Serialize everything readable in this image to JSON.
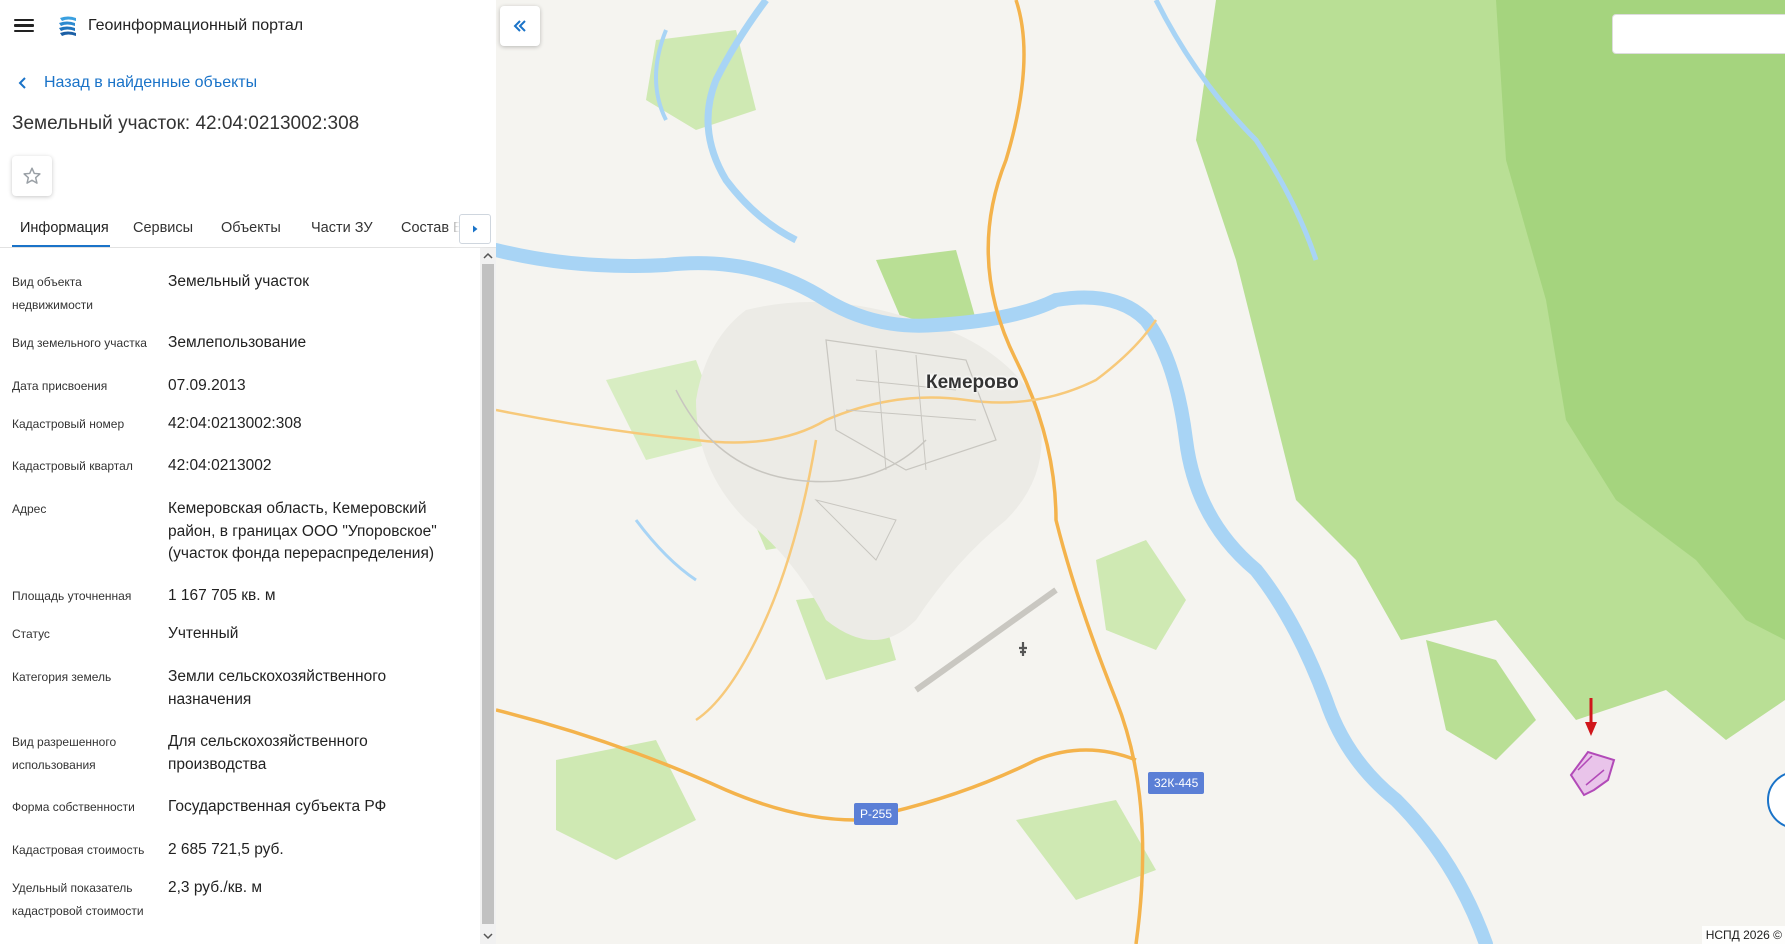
{
  "header": {
    "app_title": "Геоинформационный портал",
    "menu_icon": "hamburger-menu-icon",
    "logo_icon": "portal-logo-icon"
  },
  "panel": {
    "back_link": "Назад в найденные объекты",
    "object_title": "Земельный участок: 42:04:0213002:308",
    "favorite_icon": "star-outline-icon",
    "tabs": [
      {
        "label": "Информация",
        "active": true
      },
      {
        "label": "Сервисы",
        "active": false
      },
      {
        "label": "Объекты",
        "active": false
      },
      {
        "label": "Части ЗУ",
        "active": false
      },
      {
        "label": "Состав ЕЗП",
        "active": false
      }
    ],
    "properties": [
      {
        "label": "Вид объекта недвижимости",
        "value": "Земельный участок"
      },
      {
        "label": "Вид земельного участка",
        "value": "Землепользование"
      },
      {
        "label": "Дата присвоения",
        "value": "07.09.2013"
      },
      {
        "label": "Кадастровый номер",
        "value": "42:04:0213002:308"
      },
      {
        "label": "Кадастровый квартал",
        "value": "42:04:0213002"
      },
      {
        "label": "Адрес",
        "value": "Кемеровская область, Кемеровский район, в границах ООО \"Упоровское\" (участок фонда перераспределения)"
      },
      {
        "label": "Площадь уточненная",
        "value": "1 167 705 кв. м"
      },
      {
        "label": "Статус",
        "value": "Учтенный"
      },
      {
        "label": "Категория земель",
        "value": "Земли сельскохозяйственного назначения"
      },
      {
        "label": "Вид разрешенного использования",
        "value": "Для сельскохозяйственного производства"
      },
      {
        "label": "Форма собственности",
        "value": "Государственная субъекта РФ"
      },
      {
        "label": "Кадастровая стоимость",
        "value": "2 685 721,5 руб."
      },
      {
        "label": "Удельный показатель кадастровой стоимости",
        "value": "2,3 руб./кв. м"
      }
    ]
  },
  "map": {
    "city_label": "Кемерово",
    "road_labels": [
      "Р-255",
      "32К-445"
    ],
    "copyright": "НСПД 2026 ©",
    "search_placeholder": "",
    "colors": {
      "water": "#a8d4f5",
      "forest": "#b9df95",
      "forest_dark": "#a5d47e",
      "road_major": "#f4b34c",
      "parcel": "#b24ab8",
      "marker": "#d0161b",
      "accent": "#1a73c8"
    }
  }
}
